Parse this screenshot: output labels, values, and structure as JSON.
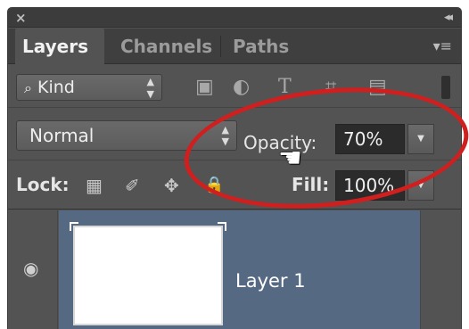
{
  "window": {
    "close_glyph": "×",
    "collapse_glyph": "◂◂"
  },
  "tabs": [
    {
      "label": "Layers",
      "active": true
    },
    {
      "label": "Channels",
      "active": false
    },
    {
      "label": "Paths",
      "active": false
    }
  ],
  "panel_menu_glyph": "▾≡",
  "filter": {
    "search_glyph": "⌕",
    "kind_label": "Kind",
    "icons": [
      "image-filter-icon",
      "adjustment-filter-icon",
      "type-filter-icon",
      "shape-filter-icon",
      "smart-object-filter-icon"
    ],
    "icon_glyphs": [
      "▣",
      "◐",
      "T",
      "⌗",
      "▤"
    ]
  },
  "blend": {
    "mode_value": "Normal",
    "opacity_label": "Opacity:",
    "opacity_value": "70%"
  },
  "lock": {
    "label": "Lock:",
    "icon_glyphs": [
      "▦",
      "✐",
      "✥",
      "🔒"
    ],
    "fill_label": "Fill:",
    "fill_value": "100%"
  },
  "layers": [
    {
      "name": "Layer 1",
      "visible": true,
      "selected": true
    }
  ],
  "colors": {
    "panel_bg": "#535353",
    "selected_layer": "#566983",
    "highlight_ellipse": "#d01f1f"
  }
}
